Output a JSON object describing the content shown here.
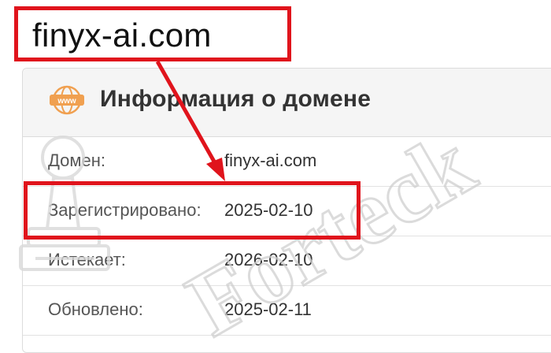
{
  "callout": {
    "text": "finyx-ai.com"
  },
  "panel": {
    "icon": "www-icon",
    "icon_text": "www",
    "title": "Информация о домене"
  },
  "rows": [
    {
      "label": "Домен:",
      "value": "finyx-ai.com"
    },
    {
      "label": "Зарегистрировано:",
      "value": "2025-02-10"
    },
    {
      "label": "Истекает:",
      "value": "2026-02-10"
    },
    {
      "label": "Обновлено:",
      "value": "2025-02-11"
    }
  ],
  "watermark": {
    "text": "Forteck"
  },
  "colors": {
    "accent_red": "#e0141c",
    "icon_orange": "#f0a050",
    "header_bg": "#f5f5f5"
  }
}
